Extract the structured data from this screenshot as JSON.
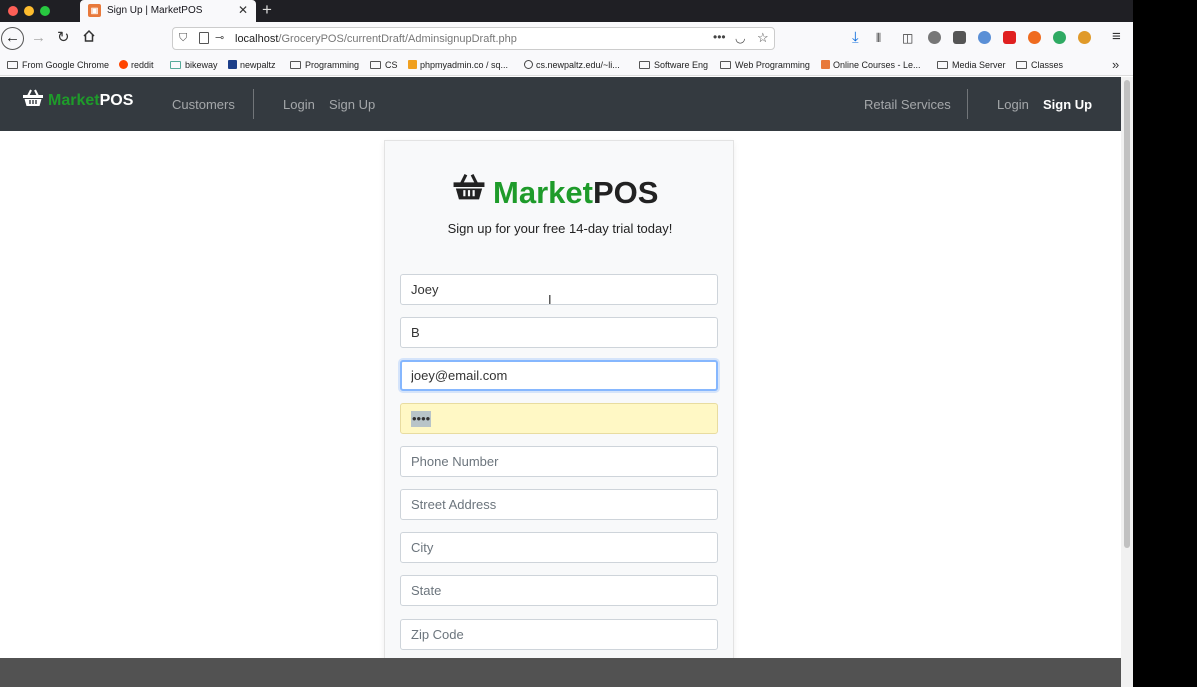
{
  "browser": {
    "tab_title": "Sign Up | MarketPOS",
    "tab_close": "✕",
    "new_tab": "+",
    "url_host": "localhost",
    "url_path": "/GroceryPOS/currentDraft/AdminsignupDraft.php",
    "url_more": "•••",
    "bookmarks": [
      "From Google Chrome",
      "reddit",
      "bikeway",
      "newpaltz",
      "Programming",
      "CS",
      "phpmyadmin.co / sq...",
      "cs.newpaltz.edu/~li...",
      "Software Eng",
      "Web Programming",
      "Online Courses - Le...",
      "Media Server",
      "Classes"
    ],
    "bookmarks_overflow": "»"
  },
  "site_nav": {
    "brand_green": "Market",
    "brand_white": "POS",
    "customers": "Customers",
    "login_left": "Login",
    "signup_left": "Sign Up",
    "retail_services": "Retail Services",
    "login_right": "Login",
    "signup_right": "Sign Up"
  },
  "signup": {
    "brand_green": "Market",
    "brand_dark": "POS",
    "tagline": "Sign up for your free 14-day trial today!",
    "first_name_value": "Joey",
    "last_name_value": "B",
    "email_value": "joey@email.com",
    "password_masked": "••••",
    "phone_placeholder": "Phone Number",
    "street_placeholder": "Street Address",
    "city_placeholder": "City",
    "state_placeholder": "State",
    "zip_placeholder": "Zip Code"
  },
  "colors": {
    "brand_green": "#1e9b2a",
    "navbar_bg": "#343a40",
    "autofill_yellow": "#fff8c5",
    "focus_border": "#86b7fe"
  }
}
